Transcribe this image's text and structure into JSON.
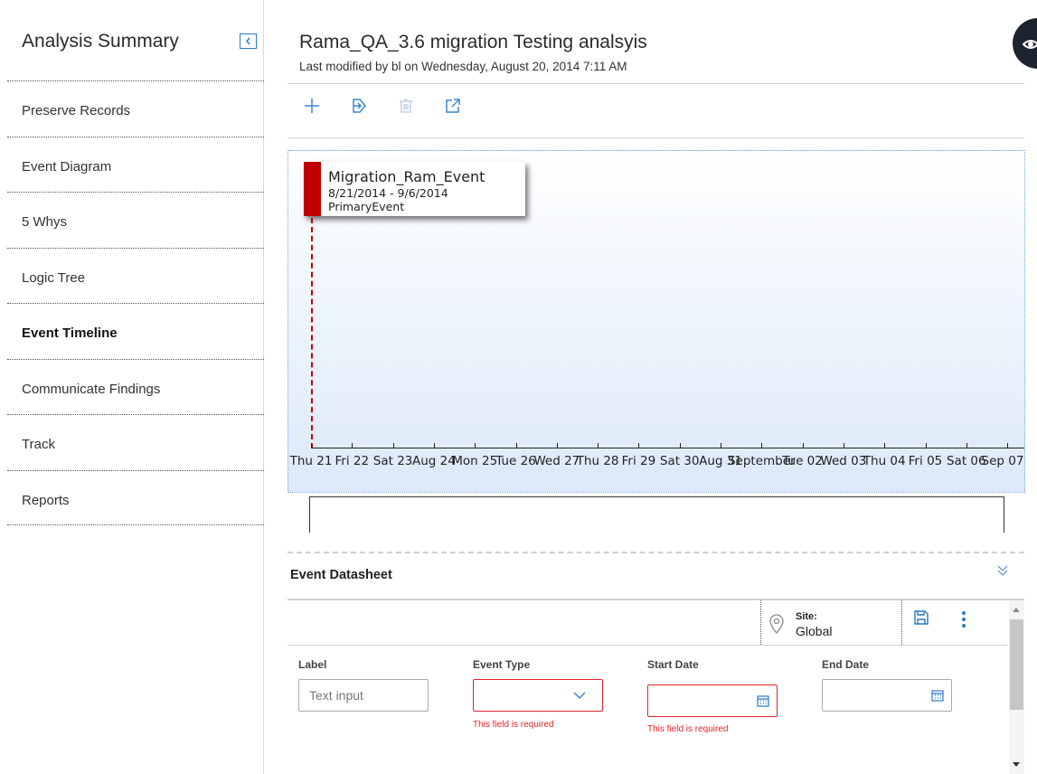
{
  "sidebar": {
    "title": "Analysis Summary",
    "items": [
      {
        "label": "Preserve Records"
      },
      {
        "label": "Event Diagram"
      },
      {
        "label": "5 Whys"
      },
      {
        "label": "Logic Tree"
      },
      {
        "label": "Event Timeline",
        "active": true
      },
      {
        "label": "Communicate Findings"
      },
      {
        "label": "Track"
      },
      {
        "label": "Reports"
      }
    ]
  },
  "header": {
    "title": "Rama_QA_3.6 migration Testing analsyis",
    "subtitle": "Last modified by bl on Wednesday, August 20, 2014 7:11 AM"
  },
  "toolbar": {
    "icons": [
      "add-icon",
      "export-icon",
      "delete-icon",
      "open-external-icon"
    ]
  },
  "timeline": {
    "event": {
      "name": "Migration_Ram_Event",
      "dates": "8/21/2014 - 9/6/2014",
      "type": "PrimaryEvent",
      "color": "#c00000"
    },
    "ticks": [
      "Thu 21",
      "Fri 22",
      "Sat 23",
      "Aug 24",
      "Mon 25",
      "Tue 26",
      "Wed 27",
      "Thu 28",
      "Fri 29",
      "Sat 30",
      "Aug 31",
      "September",
      "Tue 02",
      "Wed 03",
      "Thu 04",
      "Fri 05",
      "Sat 06",
      "Sep 07"
    ]
  },
  "datasheet": {
    "title": "Event Datasheet",
    "site_label": "Site:",
    "site_value": "Global",
    "fields": {
      "label": {
        "label": "Label",
        "placeholder": "Text input"
      },
      "event_type": {
        "label": "Event Type",
        "error": "This field is required"
      },
      "start_date": {
        "label": "Start Date",
        "error": "This field is required"
      },
      "end_date": {
        "label": "End Date"
      }
    }
  },
  "colors": {
    "accent": "#2a78c7",
    "error": "#e0232b",
    "event": "#c00000"
  }
}
